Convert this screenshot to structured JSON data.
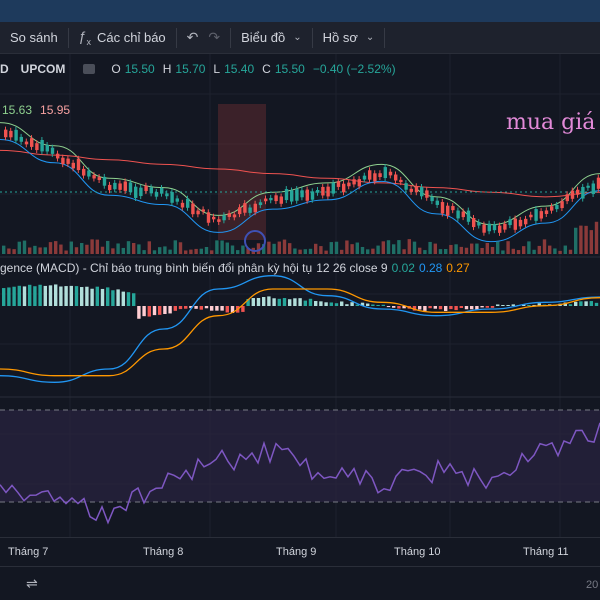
{
  "toolbar": {
    "compare_label": "So sánh",
    "indicators_icon": "fx-icon",
    "indicators_label": "Các chỉ báo",
    "undo_icon": "undo-icon",
    "redo_icon": "redo-icon",
    "chart_type_label": "Biểu đồ",
    "profile_label": "Hồ sơ"
  },
  "symbol": {
    "name": "D",
    "exchange": "UPCOM",
    "o_label": "O",
    "o": "15.50",
    "h_label": "H",
    "h": "15.70",
    "l_label": "L",
    "l": "15.40",
    "c_label": "C",
    "c": "15.50",
    "change": "−0.40 (−2.52%)"
  },
  "ma": {
    "v1": "15.63",
    "v2": "15.95"
  },
  "annotation": "mua giá",
  "macd": {
    "title": "gence (MACD) - Chỉ báo trung bình biến đổi phân kỳ hội tụ",
    "params": "12 26 close 9",
    "hist": "0.02",
    "macd": "0.28",
    "signal": "0.27"
  },
  "xaxis": {
    "labels": [
      "Tháng 7",
      "Tháng 8",
      "Tháng 9",
      "Tháng 10",
      "Tháng 11"
    ],
    "right_edge": "20"
  },
  "colors": {
    "up": "#26a69a",
    "down": "#ef5350",
    "macd_line": "#2196f3",
    "signal_line": "#ff9800",
    "rsi_line": "#7e57c2",
    "cloud": "#5c2a2f",
    "annotation": "#e28ad8"
  },
  "chart_data": {
    "type": "line",
    "title": "",
    "panels": [
      "price",
      "volume",
      "macd",
      "rsi"
    ],
    "x": [
      "Tháng 7",
      "Tháng 8",
      "Tháng 9",
      "Tháng 10",
      "Tháng 11"
    ],
    "series": [
      {
        "values": [
          17.4,
          16.9,
          16.2,
          16.0,
          15.4,
          15.9,
          16.1,
          16.5,
          15.8,
          15.2,
          15.6,
          16.3
        ]
      },
      {
        "values": [
          16.8,
          16.7,
          16.6,
          16.5,
          16.4,
          16.3,
          16.2,
          16.1,
          16.0,
          15.9,
          15.8,
          15.9
        ]
      },
      {
        "values": [
          -0.9,
          -1.0,
          -0.8,
          -0.2,
          0.4,
          0.6,
          0.3,
          0.1,
          0.0,
          0.1,
          0.2,
          0.28
        ]
      },
      {
        "values": [
          -0.8,
          -0.9,
          -0.9,
          -0.5,
          0.0,
          0.4,
          0.4,
          0.2,
          0.05,
          0.05,
          0.15,
          0.27
        ]
      },
      {
        "values": [
          42,
          35,
          28,
          45,
          55,
          60,
          48,
          44,
          50,
          46,
          62,
          70
        ]
      }
    ]
  }
}
